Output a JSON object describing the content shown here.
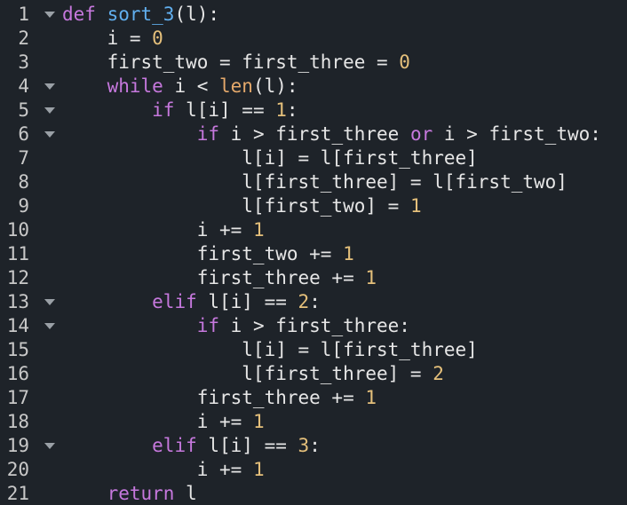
{
  "editor": {
    "lines": [
      {
        "n": "1",
        "fold": true,
        "tokens": [
          [
            "kw",
            "def"
          ],
          [
            "tx",
            " "
          ],
          [
            "fn",
            "sort_3"
          ],
          [
            "tx",
            "(l):"
          ]
        ]
      },
      {
        "n": "2",
        "fold": false,
        "tokens": [
          [
            "tx",
            "    i = "
          ],
          [
            "num",
            "0"
          ]
        ]
      },
      {
        "n": "3",
        "fold": false,
        "tokens": [
          [
            "tx",
            "    first_two = first_three = "
          ],
          [
            "num",
            "0"
          ]
        ]
      },
      {
        "n": "4",
        "fold": true,
        "tokens": [
          [
            "tx",
            "    "
          ],
          [
            "kw",
            "while"
          ],
          [
            "tx",
            " i < "
          ],
          [
            "bi",
            "len"
          ],
          [
            "tx",
            "(l):"
          ]
        ]
      },
      {
        "n": "5",
        "fold": true,
        "tokens": [
          [
            "tx",
            "        "
          ],
          [
            "kw",
            "if"
          ],
          [
            "tx",
            " l[i] == "
          ],
          [
            "num",
            "1"
          ],
          [
            "tx",
            ":"
          ]
        ]
      },
      {
        "n": "6",
        "fold": true,
        "tokens": [
          [
            "tx",
            "            "
          ],
          [
            "kw",
            "if"
          ],
          [
            "tx",
            " i > first_three "
          ],
          [
            "kw",
            "or"
          ],
          [
            "tx",
            " i > first_two:"
          ]
        ]
      },
      {
        "n": "7",
        "fold": false,
        "tokens": [
          [
            "tx",
            "                l[i] = l[first_three]"
          ]
        ]
      },
      {
        "n": "8",
        "fold": false,
        "tokens": [
          [
            "tx",
            "                l[first_three] = l[first_two]"
          ]
        ]
      },
      {
        "n": "9",
        "fold": false,
        "tokens": [
          [
            "tx",
            "                l[first_two] = "
          ],
          [
            "num",
            "1"
          ]
        ]
      },
      {
        "n": "10",
        "fold": false,
        "tokens": [
          [
            "tx",
            "            i += "
          ],
          [
            "num",
            "1"
          ]
        ]
      },
      {
        "n": "11",
        "fold": false,
        "tokens": [
          [
            "tx",
            "            first_two += "
          ],
          [
            "num",
            "1"
          ]
        ]
      },
      {
        "n": "12",
        "fold": false,
        "tokens": [
          [
            "tx",
            "            first_three += "
          ],
          [
            "num",
            "1"
          ]
        ]
      },
      {
        "n": "13",
        "fold": true,
        "tokens": [
          [
            "tx",
            "        "
          ],
          [
            "kw",
            "elif"
          ],
          [
            "tx",
            " l[i] == "
          ],
          [
            "num",
            "2"
          ],
          [
            "tx",
            ":"
          ]
        ]
      },
      {
        "n": "14",
        "fold": true,
        "tokens": [
          [
            "tx",
            "            "
          ],
          [
            "kw",
            "if"
          ],
          [
            "tx",
            " i > first_three:"
          ]
        ]
      },
      {
        "n": "15",
        "fold": false,
        "tokens": [
          [
            "tx",
            "                l[i] = l[first_three]"
          ]
        ]
      },
      {
        "n": "16",
        "fold": false,
        "tokens": [
          [
            "tx",
            "                l[first_three] = "
          ],
          [
            "num",
            "2"
          ]
        ]
      },
      {
        "n": "17",
        "fold": false,
        "tokens": [
          [
            "tx",
            "            first_three += "
          ],
          [
            "num",
            "1"
          ]
        ]
      },
      {
        "n": "18",
        "fold": false,
        "tokens": [
          [
            "tx",
            "            i += "
          ],
          [
            "num",
            "1"
          ]
        ]
      },
      {
        "n": "19",
        "fold": true,
        "tokens": [
          [
            "tx",
            "        "
          ],
          [
            "kw",
            "elif"
          ],
          [
            "tx",
            " l[i] == "
          ],
          [
            "num",
            "3"
          ],
          [
            "tx",
            ":"
          ]
        ]
      },
      {
        "n": "20",
        "fold": false,
        "tokens": [
          [
            "tx",
            "            i += "
          ],
          [
            "num",
            "1"
          ]
        ]
      },
      {
        "n": "21",
        "fold": false,
        "tokens": [
          [
            "tx",
            "    "
          ],
          [
            "kw",
            "return"
          ],
          [
            "tx",
            " l"
          ]
        ]
      }
    ],
    "colors": {
      "background": "#1e2329",
      "keyword": "#c678dd",
      "function": "#61afef",
      "number": "#e5c07b",
      "builtin": "#e5a96b",
      "text": "#e6e6e6",
      "line_number": "#c8c8c8",
      "fold_marker": "#9aa0a6"
    },
    "icons": {
      "fold": "chevron-down-icon"
    }
  }
}
